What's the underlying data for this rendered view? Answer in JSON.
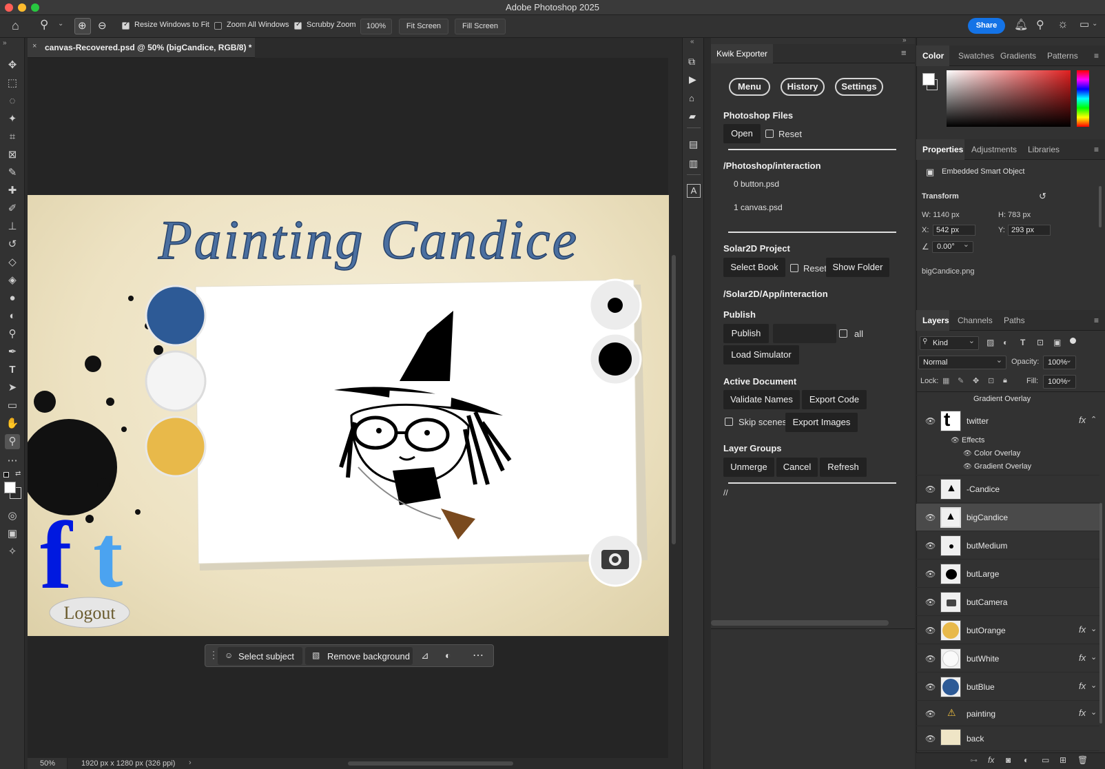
{
  "app_title": "Adobe Photoshop 2025",
  "options_bar": {
    "resize_windows": {
      "label": "Resize Windows to Fit",
      "checked": true
    },
    "zoom_all": {
      "label": "Zoom All Windows",
      "checked": false
    },
    "scrubby_zoom": {
      "label": "Scrubby Zoom",
      "checked": true
    },
    "zoom_value": "100%",
    "fit_screen": "Fit Screen",
    "fill_screen": "Fill Screen",
    "share": "Share"
  },
  "document": {
    "tab_title": "canvas-Recovered.psd @ 50% (bigCandice, RGB/8) *",
    "zoom": "50%",
    "dimensions": "1920 px x 1280 px (326 ppi)",
    "canvas_title": "Painting Candice",
    "logout_label": "Logout",
    "circle_colors": {
      "blue": "#2d5a96",
      "white": "#f4f4f4",
      "orange": "#e8b94a"
    }
  },
  "contextual_bar": {
    "select_subject": "Select subject",
    "remove_background": "Remove background"
  },
  "kwik": {
    "title": "Kwik Exporter",
    "menu": "Menu",
    "history": "History",
    "settings": "Settings",
    "photoshop_files": "Photoshop Files",
    "open": "Open",
    "reset": "Reset",
    "ps_path": "/Photoshop/interaction",
    "files": [
      "0 button.psd",
      "1 canvas.psd"
    ],
    "solar2d_project": "Solar2D Project",
    "select_book": "Select Book",
    "reset2": "Reset",
    "show_folder": "Show Folder",
    "solar_path": "/Solar2D/App/interaction",
    "publish_header": "Publish",
    "publish": "Publish",
    "all": "all",
    "load_simulator": "Load Simulator",
    "active_document": "Active Document",
    "validate_names": "Validate Names",
    "export_code": "Export Code",
    "skip_scenes": "Skip scenes",
    "export_images": "Export Images",
    "layer_groups": "Layer Groups",
    "unmerge": "Unmerge",
    "cancel": "Cancel",
    "refresh": "Refresh",
    "footer": "//"
  },
  "color_panel": {
    "tabs": [
      "Color",
      "Swatches",
      "Gradients",
      "Patterns"
    ]
  },
  "properties": {
    "tabs": [
      "Properties",
      "Adjustments",
      "Libraries"
    ],
    "type": "Embedded Smart Object",
    "transform": "Transform",
    "w": "W:  1140 px",
    "h": "H:  783 px",
    "x_label": "X:",
    "x": "542 px",
    "y_label": "Y:",
    "y": "293 px",
    "angle": "0.00°",
    "file": "bigCandice.png"
  },
  "layers_panel": {
    "tabs": [
      "Layers",
      "Channels",
      "Paths"
    ],
    "kind": "Kind",
    "blend": "Normal",
    "opacity_label": "Opacity:",
    "opacity": "100%",
    "lock_label": "Lock:",
    "fill_label": "Fill:",
    "fill": "100%",
    "top_effect": "Gradient Overlay",
    "twitter": "twitter",
    "effects": "Effects",
    "color_overlay": "Color Overlay",
    "gradient_overlay": "Gradient Overlay",
    "layers": [
      "-Candice",
      "bigCandice",
      "butMedium",
      "butLarge",
      "butCamera",
      "butOrange",
      "butWhite",
      "butBlue",
      "painting",
      "back"
    ]
  }
}
